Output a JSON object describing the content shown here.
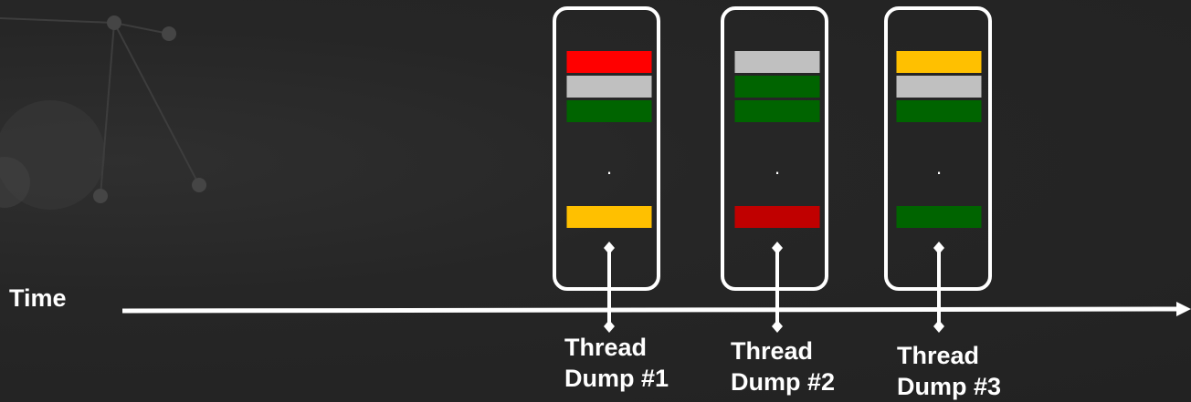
{
  "heading": "",
  "time_label": "Time",
  "colors": {
    "red": "#ff0000",
    "gray": "#c0c0c0",
    "green": "#006400",
    "yellow": "#ffc000",
    "dark_red": "#c00000"
  },
  "dumps": [
    {
      "line1": "Thread",
      "line2": "Dump #1",
      "top_bars": [
        "red",
        "gray",
        "green"
      ],
      "ellipsis": "·",
      "bottom_bar": "yellow"
    },
    {
      "line1": "Thread",
      "line2": "Dump #2",
      "top_bars": [
        "gray",
        "green",
        "green"
      ],
      "ellipsis": "·",
      "bottom_bar": "dark_red"
    },
    {
      "line1": "Thread",
      "line2": "Dump #3",
      "top_bars": [
        "yellow",
        "gray",
        "green"
      ],
      "ellipsis": "·",
      "bottom_bar": "green"
    }
  ]
}
